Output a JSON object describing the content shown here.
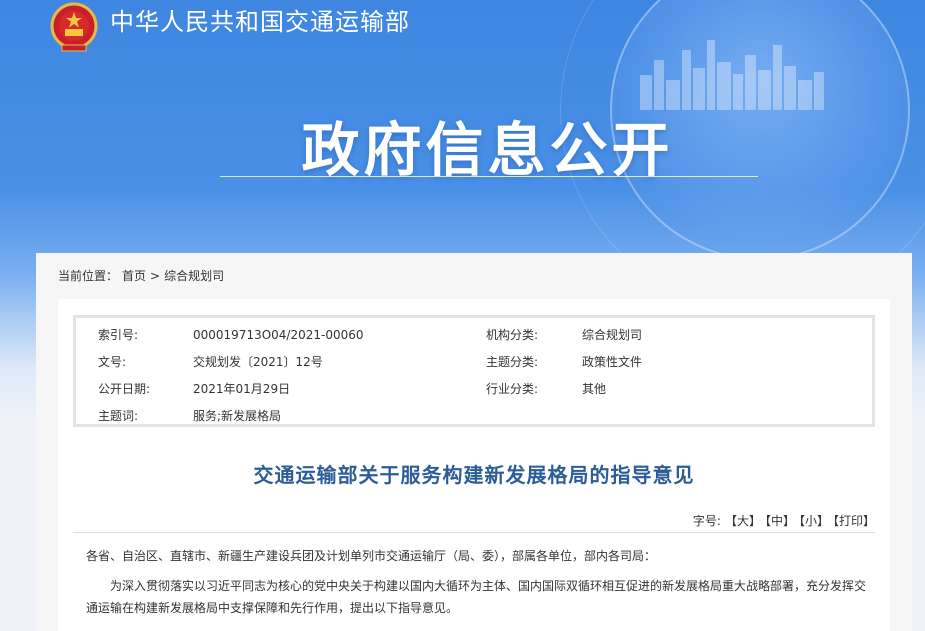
{
  "header": {
    "ministry_name": "中华人民共和国交通运输部",
    "section_title": "政府信息公开"
  },
  "breadcrumb": {
    "label": "当前位置：",
    "items": [
      "首页",
      "综合规划司"
    ],
    "separator": ">"
  },
  "meta": {
    "rows": [
      {
        "k1": "索引号:",
        "v1": "000019713O04/2021-00060",
        "k2": "机构分类:",
        "v2": "综合规划司"
      },
      {
        "k1": "文号:",
        "v1": "交规划发〔2021〕12号",
        "k2": "主题分类:",
        "v2": "政策性文件"
      },
      {
        "k1": "公开日期:",
        "v1": "2021年01月29日",
        "k2": "行业分类:",
        "v2": "其他"
      },
      {
        "k1": "主题词:",
        "v1": "服务;新发展格局",
        "k2": "",
        "v2": ""
      }
    ]
  },
  "document": {
    "title": "交通运输部关于服务构建新发展格局的指导意见",
    "addressee": "各省、自治区、直辖市、新疆生产建设兵团及计划单列市交通运输厅（局、委），部属各单位，部内各司局：",
    "intro": "为深入贯彻落实以习近平同志为核心的党中央关于构建以国内大循环为主体、国内国际双循环相互促进的新发展格局重大战略部署，充分发挥交通运输在构建新发展格局中支撑保障和先行作用，提出以下指导意见。"
  },
  "toolbar": {
    "font_label": "字号:",
    "large": "【大】",
    "medium": "【中】",
    "small": "【小】",
    "print": "【打印】"
  },
  "colors": {
    "banner_blue": "#4a90e6",
    "title_blue": "#2c5d97"
  }
}
